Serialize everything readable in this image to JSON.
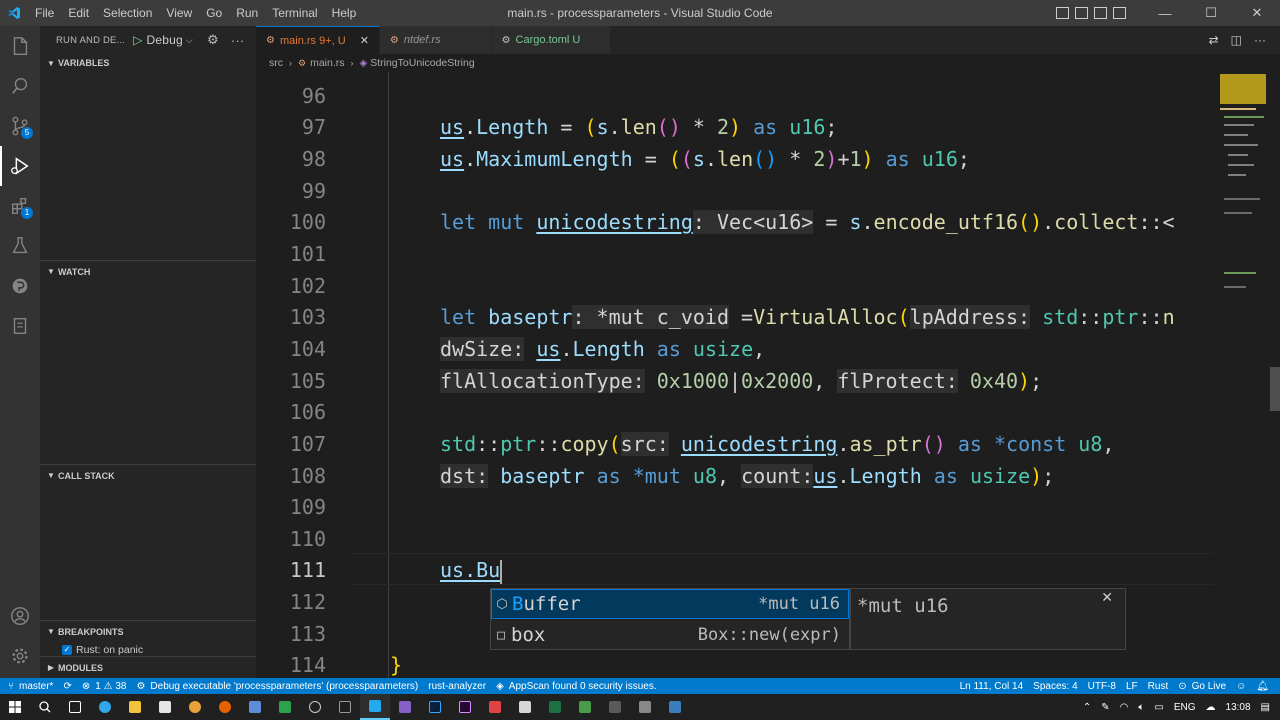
{
  "titlebar": {
    "menu": [
      "File",
      "Edit",
      "Selection",
      "View",
      "Go",
      "Run",
      "Terminal",
      "Help"
    ],
    "title": "main.rs - processparameters - Visual Studio Code"
  },
  "activity": {
    "source_control_badge": "5",
    "extensions_badge": "1"
  },
  "sidebar": {
    "header": "RUN AND DE...",
    "config": "Debug",
    "sections": {
      "variables": "VARIABLES",
      "watch": "WATCH",
      "call_stack": "CALL STACK",
      "breakpoints": "BREAKPOINTS",
      "modules": "MODULES"
    },
    "breakpoint_item": "Rust: on panic"
  },
  "tabs": [
    {
      "label": "main.rs",
      "status": "9+, U"
    },
    {
      "label": "ntdef.rs"
    },
    {
      "label": "Cargo.toml",
      "status": "U"
    }
  ],
  "breadcrumb": [
    "src",
    "main.rs",
    "StringToUnicodeString"
  ],
  "editor": {
    "line_numbers": [
      "96",
      "97",
      "98",
      "99",
      "100",
      "101",
      "102",
      "103",
      "104",
      "105",
      "106",
      "107",
      "108",
      "109",
      "110",
      "111",
      "112",
      "113",
      "114"
    ],
    "typed_text": "us.Bu"
  },
  "suggest": {
    "items": [
      {
        "match": "B",
        "rest": "uffer",
        "detail": "*mut u16",
        "icon": "field-icon"
      },
      {
        "match": "",
        "rest": "box",
        "detail": "Box::new(expr)",
        "icon": "snippet-icon"
      }
    ],
    "doc": "*mut u16"
  },
  "statusbar": {
    "branch": "master*",
    "problems": "1 ⚠ 38",
    "debug": "Debug executable 'processparameters' (processparameters)",
    "analyzer": "rust-analyzer",
    "appscan": "AppScan found 0 security issues.",
    "position": "Ln 111, Col 14",
    "spaces": "Spaces: 4",
    "encoding": "UTF-8",
    "eol": "LF",
    "language": "Rust",
    "golive": "Go Live"
  },
  "taskbar": {
    "lang": "ENG",
    "time": "13:08"
  },
  "colors": {
    "accent": "#007acc",
    "keyword": "#569cd6",
    "variable": "#9cdcfe",
    "function": "#dcdcaa",
    "type": "#4ec9b0",
    "number": "#b5cea8"
  }
}
